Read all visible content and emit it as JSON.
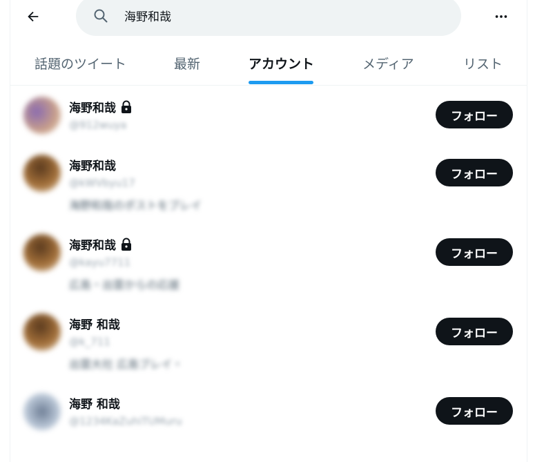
{
  "search": {
    "query": "海野和哉"
  },
  "icons": {
    "back": "arrow-left-icon",
    "search": "magnifier-icon",
    "more": "ellipsis-icon",
    "lock": "lock-icon"
  },
  "tabs": [
    {
      "label": "話題のツイート",
      "active": false
    },
    {
      "label": "最新",
      "active": false
    },
    {
      "label": "アカウント",
      "active": true
    },
    {
      "label": "メディア",
      "active": false
    },
    {
      "label": "リスト",
      "active": false
    }
  ],
  "colors": {
    "accent": "#1d9bf0",
    "follow_button_bg": "#0f1419",
    "search_bg": "#eff3f4"
  },
  "users": [
    {
      "name": "海野和哉",
      "locked": true,
      "handle": "@912wuya",
      "bio": "",
      "follow_label": "フォロー"
    },
    {
      "name": "海野和哉",
      "locked": false,
      "handle": "@kWVbyu17",
      "bio": "海野和哉のポストをブレイ",
      "follow_label": "フォロー"
    },
    {
      "name": "海野和哉",
      "locked": true,
      "handle": "@kayu7711",
      "bio": "広島・出雲からの応援",
      "follow_label": "フォロー"
    },
    {
      "name": "海野 和哉",
      "locked": false,
      "handle": "@k_711",
      "bio": "出雲大社 広島ブレイ・",
      "follow_label": "フォロー"
    },
    {
      "name": "海野 和哉",
      "locked": false,
      "handle": "@1234KaZuhiTUMuru",
      "bio": "",
      "follow_label": "フォロー"
    }
  ]
}
